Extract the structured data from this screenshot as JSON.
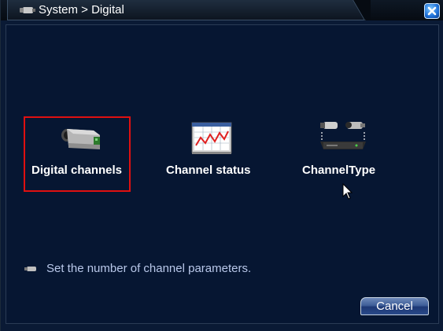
{
  "window": {
    "title": "System > Digital",
    "icon": "camera-icon",
    "close_icon": "close-icon"
  },
  "items": [
    {
      "label": "Digital channels",
      "icon": "ip-camera-icon",
      "selected": true
    },
    {
      "label": "Channel status",
      "icon": "status-chart-icon",
      "selected": false
    },
    {
      "label": "ChannelType",
      "icon": "camera-dvr-icon",
      "selected": false
    }
  ],
  "hint": {
    "text": "Set the number of channel parameters.",
    "icon": "info-camera-icon"
  },
  "buttons": {
    "cancel": "Cancel"
  },
  "colors": {
    "background": "#061632",
    "selection": "#e01010",
    "hint_text": "#b9c8ea",
    "close_button": "#1c6fd8"
  }
}
